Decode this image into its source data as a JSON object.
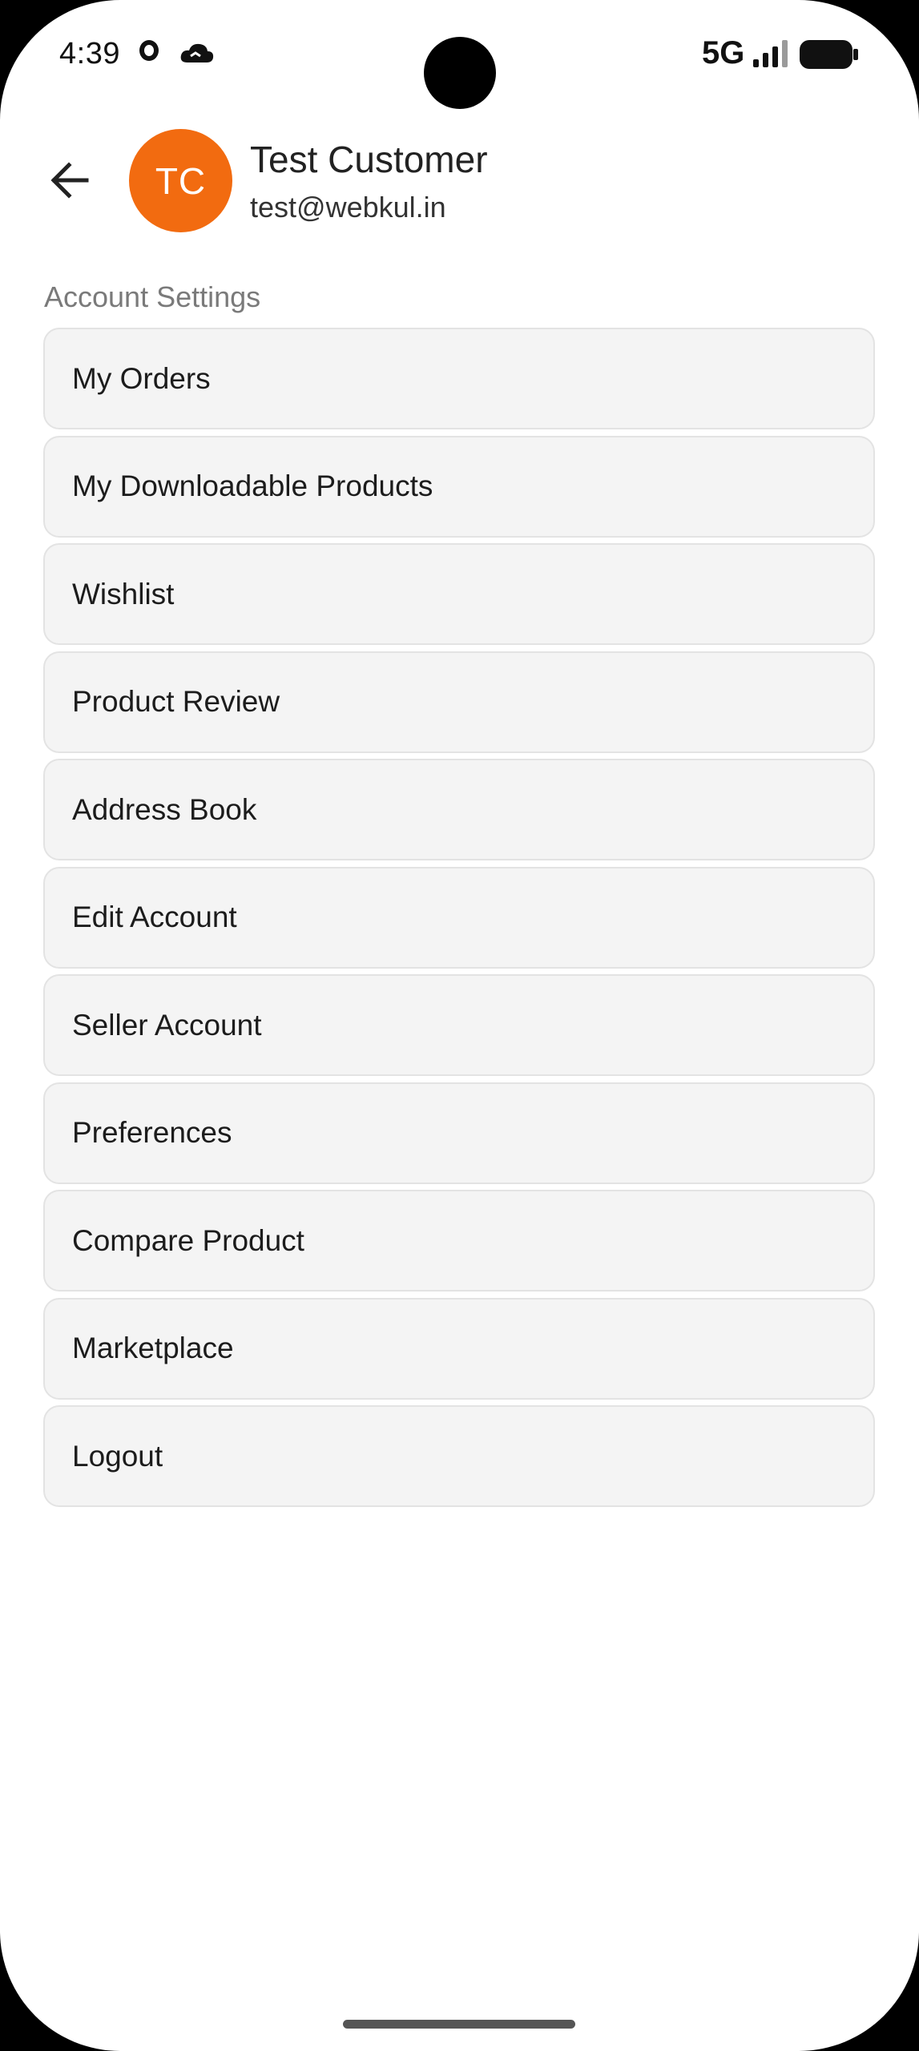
{
  "status_bar": {
    "time": "4:39",
    "network": "5G",
    "icons": [
      "o-icon",
      "cloud-icon",
      "signal-icon",
      "battery-icon"
    ]
  },
  "header": {
    "back_icon": "arrow-left-icon",
    "avatar_initials": "TC",
    "avatar_color": "#f26b10",
    "name": "Test Customer",
    "email": "test@webkul.in"
  },
  "account_settings": {
    "title": "Account Settings",
    "items": [
      {
        "label": "My Orders"
      },
      {
        "label": "My Downloadable Products"
      },
      {
        "label": "Wishlist"
      },
      {
        "label": "Product Review"
      },
      {
        "label": "Address Book"
      },
      {
        "label": "Edit Account"
      },
      {
        "label": "Seller Account"
      },
      {
        "label": "Preferences"
      },
      {
        "label": "Compare Product"
      },
      {
        "label": "Marketplace"
      },
      {
        "label": "Logout"
      }
    ]
  }
}
